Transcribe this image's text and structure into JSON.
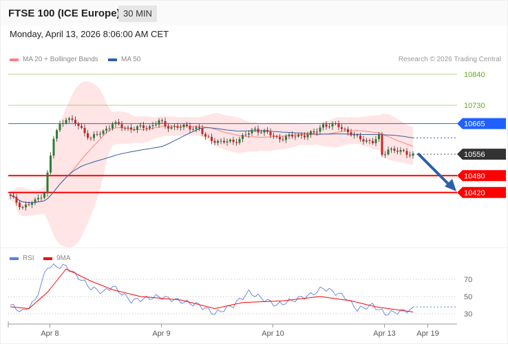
{
  "header": {
    "title": "FTSE 100 (ICE Europe)",
    "timeframe": "30 MIN",
    "datetime": "Monday, April 13, 2026 8:06:00 AM CET"
  },
  "legend": {
    "ma20": "MA 20 + Bollinger Bands",
    "ma50": "MA 50",
    "credit": "Research © 2026 Trading Central"
  },
  "rsi_legend": {
    "rsi": "RSI",
    "ma": "9MA"
  },
  "colors": {
    "up": "#2e7d32",
    "down": "#c62828",
    "ma20": "#ff8080",
    "band": "#ffdede",
    "ma50": "#2f5fa8",
    "resistance": "#2060ff",
    "support": "#ff0000",
    "target": "#66aa22",
    "last": "#333333",
    "arrow": "#2f5fa8"
  },
  "chart_data": {
    "type": "candlestick",
    "ylim": [
      10360,
      10880
    ],
    "levels": [
      {
        "label": "10840",
        "value": 10840,
        "kind": "target"
      },
      {
        "label": "10730",
        "value": 10730,
        "kind": "target"
      },
      {
        "label": "10665",
        "value": 10665,
        "kind": "resistance"
      },
      {
        "label": "10556",
        "value": 10556,
        "kind": "last"
      },
      {
        "label": "10480",
        "value": 10480,
        "kind": "support"
      },
      {
        "label": "10420",
        "value": 10420,
        "kind": "support"
      }
    ],
    "x_ticks": [
      {
        "label": "Apr 8",
        "index": 13
      },
      {
        "label": "Apr 9",
        "index": 49
      },
      {
        "label": "Apr 10",
        "index": 85
      },
      {
        "label": "Apr 13",
        "index": 121
      },
      {
        "label": "Apr 19",
        "index": 135
      }
    ],
    "close_keypoints": [
      [
        0,
        10405
      ],
      [
        4,
        10368
      ],
      [
        8,
        10388
      ],
      [
        11,
        10422
      ],
      [
        14,
        10613
      ],
      [
        16,
        10661
      ],
      [
        18,
        10686
      ],
      [
        21,
        10666
      ],
      [
        26,
        10613
      ],
      [
        30,
        10637
      ],
      [
        33,
        10666
      ],
      [
        37,
        10649
      ],
      [
        41,
        10649
      ],
      [
        45,
        10654
      ],
      [
        48,
        10674
      ],
      [
        50,
        10654
      ],
      [
        54,
        10654
      ],
      [
        61,
        10649
      ],
      [
        63,
        10613
      ],
      [
        68,
        10600
      ],
      [
        72,
        10600
      ],
      [
        76,
        10625
      ],
      [
        79,
        10644
      ],
      [
        82,
        10637
      ],
      [
        86,
        10613
      ],
      [
        90,
        10618
      ],
      [
        95,
        10625
      ],
      [
        98,
        10630
      ],
      [
        101,
        10661
      ],
      [
        106,
        10656
      ],
      [
        109,
        10637
      ],
      [
        112,
        10613
      ],
      [
        117,
        10600
      ],
      [
        119,
        10618
      ],
      [
        120,
        10551
      ],
      [
        122,
        10576
      ],
      [
        126,
        10564
      ],
      [
        130,
        10556
      ]
    ],
    "rsi": {
      "ylim": [
        20,
        90
      ],
      "ticks": [
        70,
        50,
        30
      ],
      "rsi_keypoints": [
        [
          0,
          40
        ],
        [
          4,
          32
        ],
        [
          8,
          45
        ],
        [
          12,
          85
        ],
        [
          18,
          85
        ],
        [
          26,
          60
        ],
        [
          30,
          55
        ],
        [
          33,
          62
        ],
        [
          39,
          45
        ],
        [
          48,
          50
        ],
        [
          61,
          40
        ],
        [
          66,
          30
        ],
        [
          72,
          40
        ],
        [
          77,
          55
        ],
        [
          86,
          40
        ],
        [
          97,
          52
        ],
        [
          101,
          60
        ],
        [
          108,
          50
        ],
        [
          112,
          35
        ],
        [
          117,
          40
        ],
        [
          121,
          30
        ],
        [
          130,
          35
        ]
      ],
      "ma_keypoints": [
        [
          0,
          38
        ],
        [
          6,
          36
        ],
        [
          12,
          55
        ],
        [
          18,
          82
        ],
        [
          26,
          68
        ],
        [
          33,
          58
        ],
        [
          42,
          50
        ],
        [
          55,
          46
        ],
        [
          66,
          36
        ],
        [
          75,
          43
        ],
        [
          88,
          45
        ],
        [
          100,
          50
        ],
        [
          110,
          45
        ],
        [
          118,
          38
        ],
        [
          130,
          32
        ]
      ]
    }
  }
}
